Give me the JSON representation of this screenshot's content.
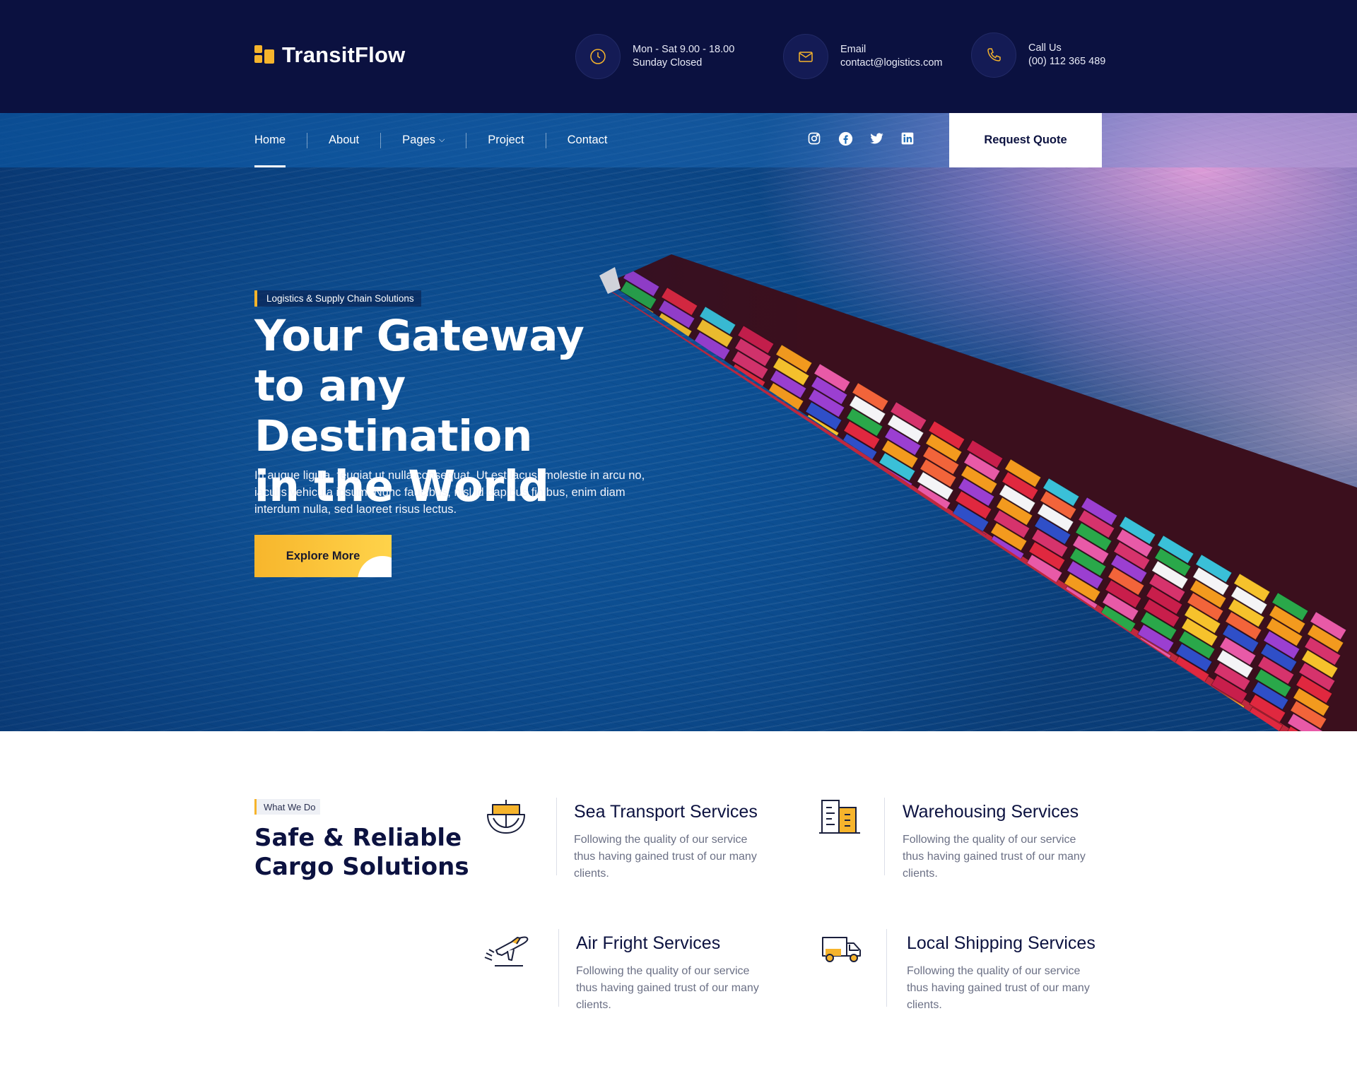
{
  "brand": {
    "name": "TransitFlow"
  },
  "contact": {
    "hours": {
      "line1": "Mon - Sat 9.00 - 18.00",
      "line2": "Sunday Closed",
      "icon": "clock-icon"
    },
    "email": {
      "label": "Email",
      "value": "contact@logistics.com",
      "icon": "mail-icon"
    },
    "phone": {
      "label": "Call Us",
      "value": "(00) 112 365 489",
      "icon": "phone-icon"
    }
  },
  "nav": {
    "items": [
      {
        "label": "Home",
        "active": true
      },
      {
        "label": "About"
      },
      {
        "label": "Pages",
        "has_dropdown": true
      },
      {
        "label": "Project"
      },
      {
        "label": "Contact"
      }
    ],
    "social": [
      "instagram-icon",
      "facebook-icon",
      "twitter-icon",
      "linkedin-icon"
    ],
    "quote_button": "Request Quote"
  },
  "hero": {
    "tag": "Logistics & Supply Chain Solutions",
    "title_lines": [
      "Your Gateway",
      "to any Destination",
      "in the World"
    ],
    "description": "In augue ligula, feugiat ut nulla consequat. Ut est lacus, molestie in arcu no, iaculis vehicula ipsum. Nunc faucibus, nisl id dapibus finibus, enim diam interdum nulla, sed laoreet risus lectus.",
    "button": "Explore More"
  },
  "services": {
    "tag": "What We Do",
    "title_lines": [
      "Safe & Reliable",
      "Cargo Solutions"
    ],
    "items": [
      {
        "title": "Sea Transport Services",
        "desc": "Following the quality of our service thus having gained trust of our many clients.",
        "icon": "ship-icon"
      },
      {
        "title": "Warehousing Services",
        "desc": "Following the quality of our service thus having gained trust of our many clients.",
        "icon": "warehouse-icon"
      },
      {
        "title": "Air Fright Services",
        "desc": "Following the quality of our service thus having gained trust of our many clients.",
        "icon": "airplane-icon"
      },
      {
        "title": "Local Shipping Services",
        "desc": "Following the quality of our service thus having gained trust of our many clients.",
        "icon": "truck-icon"
      }
    ]
  },
  "colors": {
    "navy": "#0b1140",
    "accent": "#f6b42c",
    "muted_text": "#6b7085"
  }
}
